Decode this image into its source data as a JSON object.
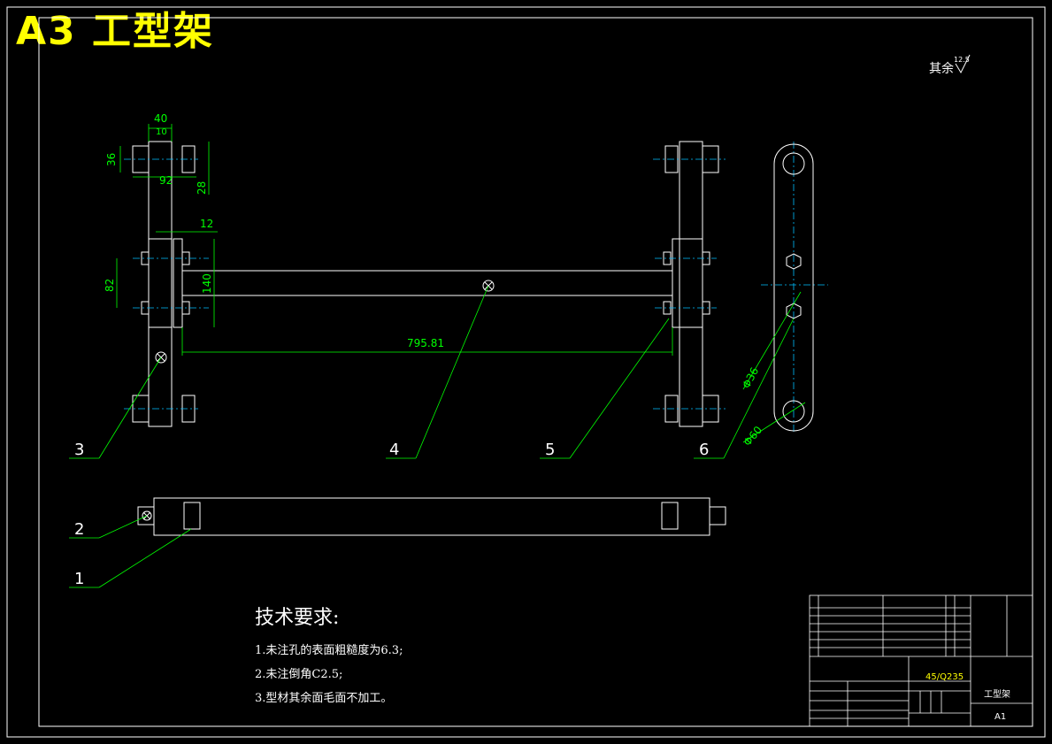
{
  "header": {
    "title": "A3 工型架"
  },
  "surface_note": {
    "label": "其余",
    "value": "12.5"
  },
  "dimensions": {
    "d40": "40",
    "d10": "10",
    "d36": "36",
    "d92": "92",
    "d28": "28",
    "d12": "12",
    "d82": "82",
    "d140": "140",
    "d795": "795.81",
    "phi36": "Φ36",
    "phi60": "Φ60"
  },
  "callouts": [
    "1",
    "2",
    "3",
    "4",
    "5",
    "6"
  ],
  "requirements": {
    "title": "技术要求:",
    "items": [
      "1.未注孔的表面粗糙度为6.3;",
      "2.未注倒角C2.5;",
      "3.型材其余面毛面不加工。"
    ]
  },
  "title_block": {
    "material": "45/Q235",
    "name": "工型架",
    "code": "A1"
  },
  "colors": {
    "line": "#ffffff",
    "dimension": "#00ff00",
    "title": "#ffff00",
    "centerline": "#00bfff"
  }
}
